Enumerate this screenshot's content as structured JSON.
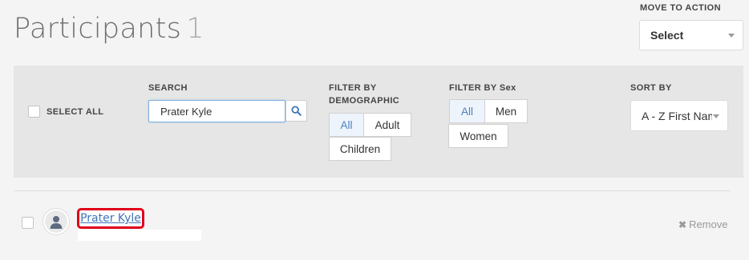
{
  "header": {
    "title": "Participants",
    "count": "1"
  },
  "move_to_action": {
    "label": "MOVE TO ACTION",
    "selected": "Select"
  },
  "filters": {
    "select_all_label": "SELECT ALL",
    "search": {
      "label": "SEARCH",
      "value": "Prater Kyle"
    },
    "demographic": {
      "label_line1": "FILTER BY",
      "label_line2": "DEMOGRAPHIC",
      "options": [
        "All",
        "Adult",
        "Children"
      ],
      "selected": "All"
    },
    "sex": {
      "label": "FILTER BY Sex",
      "options": [
        "All",
        "Men",
        "Women"
      ],
      "selected": "All"
    },
    "sort": {
      "label": "SORT BY",
      "selected": "A - Z First Name"
    }
  },
  "participants": [
    {
      "name": "Prater Kyle",
      "remove_label": "Remove"
    }
  ],
  "icons": {
    "search": "search-icon",
    "avatar": "user-silhouette-icon",
    "remove": "close-icon",
    "caret": "chevron-down-icon"
  },
  "colors": {
    "accent": "#3f74b8",
    "highlight_box": "#e0001a",
    "filter_bar_bg": "#e6e6e6"
  }
}
